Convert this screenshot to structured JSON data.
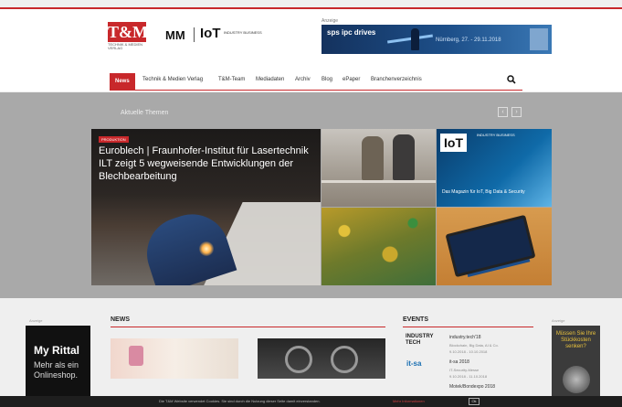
{
  "header": {
    "logo_tm": "T&M",
    "logo_tm_sub": "TECHNIK & MEDIEN VERLAG",
    "logo_mm": "MM",
    "logo_iot": "IoT",
    "logo_iot_tag": "INDUSTRY BUSINESS",
    "ad_label": "Anzeige",
    "ad_banner": {
      "title": "sps ipc drives",
      "date": "Nürnberg, 27. - 29.11.2018"
    }
  },
  "nav": {
    "items": [
      {
        "label": "News",
        "active": true
      },
      {
        "label": "Technik & Medien Verlag"
      },
      {
        "label": "T&M-Team"
      },
      {
        "label": "Mediadaten"
      },
      {
        "label": "Archiv"
      },
      {
        "label": "Blog"
      },
      {
        "label": "ePaper"
      },
      {
        "label": "Branchenverzeichnis"
      }
    ],
    "search_icon": "search-icon"
  },
  "topics": {
    "title": "Aktuelle Themen",
    "prev": "‹",
    "next": "›",
    "featured": {
      "tag": "PRODUKTION",
      "headline": "Euroblech | Fraunhofer-Institut für Lasertechnik ILT zeigt 5 wegweisende Entwicklungen der Blechbearbeitung"
    },
    "tile_iot": {
      "logo": "IoT",
      "sub": "INDUSTRY BUSINESS",
      "caption": "Das Magazin für IoT, Big Data & Security"
    }
  },
  "sidebar_left": {
    "ad_label": "Anzeige",
    "headline": "My Rittal",
    "subline": "Mehr als ein Onlineshop."
  },
  "news": {
    "title": "NEWS"
  },
  "events": {
    "title": "EVENTS",
    "items": [
      {
        "logo": "INDUSTRY TECH",
        "name": "industry.tech'18",
        "desc": "Blockchain, Big Data, AI & Co.",
        "date": "9.10.2018 - 10.10.2018"
      },
      {
        "logo": "it-sa",
        "name": "it-sa 2018",
        "desc": "IT-Security-Messe",
        "date": "9.10.2018 - 11.10.2018"
      },
      {
        "name": "Motek/Bondexpo 2018",
        "date": ""
      }
    ]
  },
  "sidebar_right": {
    "ad_label": "Anzeige",
    "text": "Müssen Sie Ihre Stückkosten senken?"
  },
  "cookie": {
    "text": "Die T&M Website verwendet Cookies. Sie sind durch die Nutzung dieser Seite damit einverstanden.",
    "link": "Mehr Informationen",
    "ok": "Ok"
  }
}
